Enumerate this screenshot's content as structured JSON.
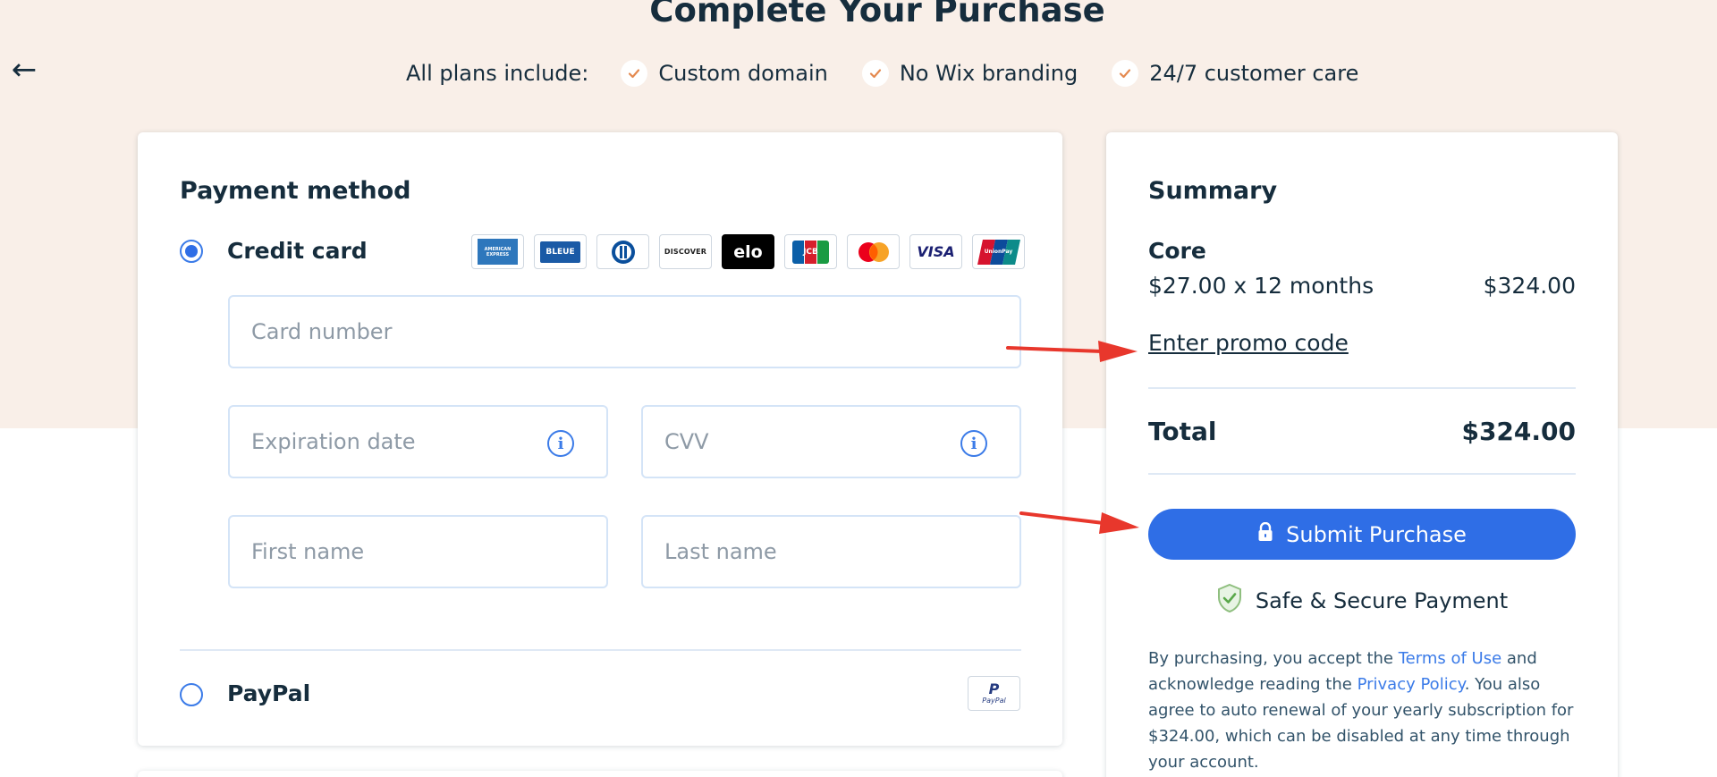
{
  "header": {
    "title": "Complete Your Purchase",
    "includes_label": "All plans include:",
    "includes": [
      "Custom domain",
      "No Wix branding",
      "24/7 customer care"
    ]
  },
  "payment": {
    "heading": "Payment method",
    "credit_card_label": "Credit card",
    "card_logos": [
      "AMERICAN EXPRESS",
      "BLEUE",
      "Diners",
      "DISCOVER",
      "elo",
      "JCB",
      "Mastercard",
      "VISA",
      "UnionPay"
    ],
    "fields": {
      "card_number": "Card number",
      "expiration": "Expiration date",
      "cvv": "CVV",
      "first_name": "First name",
      "last_name": "Last name"
    },
    "paypal_label": "PayPal",
    "paypal_logo": "PayPal"
  },
  "summary": {
    "heading": "Summary",
    "plan": "Core",
    "plan_detail": "$27.00 x 12 months",
    "plan_price": "$324.00",
    "promo_link": "Enter promo code",
    "total_label": "Total",
    "total_value": "$324.00",
    "submit_label": "Submit Purchase",
    "secure_label": "Safe & Secure Payment",
    "legal": {
      "part1": "By purchasing, you accept the ",
      "terms_link": "Terms of Use",
      "part2": " and acknowledge reading the ",
      "privacy_link": "Privacy Policy",
      "part3": ". You also agree to auto renewal of your yearly subscription for $324.00, which can be disabled at any time through your account."
    }
  },
  "colors": {
    "band": "#f9efe8",
    "primary": "#2f6ee6",
    "text": "#162d3d",
    "annotation": "#e8372c",
    "check": "#e4894f"
  },
  "icons": {
    "back": "left-arrow-icon",
    "check": "check-icon",
    "info": "info-icon",
    "lock": "lock-icon",
    "shield": "shield-check-icon"
  }
}
